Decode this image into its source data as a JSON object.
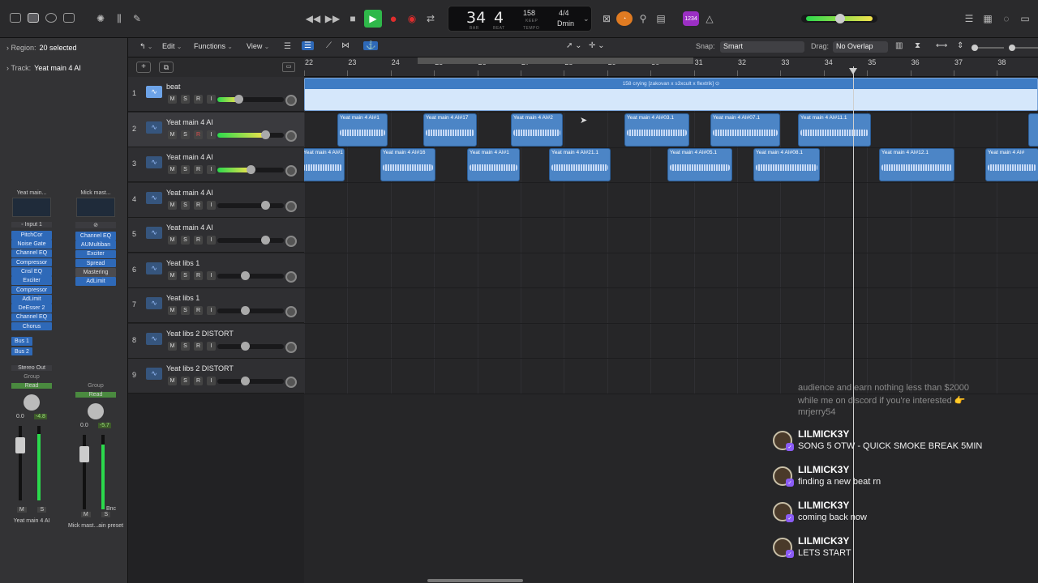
{
  "transport": {
    "bar": "34",
    "beat": "4",
    "bar_label": "BAR",
    "beat_label": "BEAT",
    "tempo": "158",
    "tempo_mode": "KEEP",
    "tempo_label": "TEMPO",
    "signature": "4/4",
    "key": "Dmin",
    "count_in_badge": "1234"
  },
  "inspector": {
    "region_label": "Region:",
    "region_value": "20 selected",
    "track_label": "Track:",
    "track_value": "Yeat main 4 AI",
    "strip1": {
      "setting": "Yeat main...",
      "input": "Input 1",
      "plugins": [
        "PitchCor",
        "Noise Gate",
        "Channel EQ",
        "Compressor",
        "Cnsl EQ",
        "Exciter",
        "Compressor",
        "AdLimit",
        "DeEsser 2",
        "Channel EQ",
        "Chorus"
      ],
      "sends": [
        "Bus 1",
        "Bus 2"
      ],
      "output": "Stereo Out",
      "group": "Group",
      "automation": "Read",
      "volume": "0.0",
      "peak": "-4.8",
      "mute": "M",
      "solo": "S",
      "name": "Yeat main 4 AI"
    },
    "strip2": {
      "setting": "Mick mast...",
      "plugins": [
        "Channel EQ",
        "AUMultiban",
        "Exciter",
        "Spread",
        "Mastering",
        "AdLimit"
      ],
      "group": "Group",
      "automation": "Read",
      "volume": "0.0",
      "peak": "-5.7",
      "bounce": "Bnc",
      "mute": "M",
      "solo": "S",
      "name": "Mick mast...ain preset"
    }
  },
  "toolbar": {
    "edit": "Edit",
    "functions": "Functions",
    "view": "View",
    "snap_label": "Snap:",
    "snap_value": "Smart",
    "drag_label": "Drag:",
    "drag_value": "No Overlap"
  },
  "ruler": [
    "22",
    "23",
    "24",
    "25",
    "26",
    "27",
    "28",
    "29",
    "30",
    "31",
    "32",
    "33",
    "34",
    "35",
    "36",
    "37",
    "38"
  ],
  "tracks": [
    {
      "num": "1",
      "name": "beat",
      "level": 0.32
    },
    {
      "num": "2",
      "name": "Yeat main 4 AI",
      "level": 0.72
    },
    {
      "num": "3",
      "name": "Yeat main 4 AI",
      "level": 0.5
    },
    {
      "num": "4",
      "name": "Yeat main 4 AI",
      "level": 0.72
    },
    {
      "num": "5",
      "name": "Yeat main 4 AI",
      "level": 0.72
    },
    {
      "num": "6",
      "name": "Yeat libs 1",
      "level": 0.42
    },
    {
      "num": "7",
      "name": "Yeat libs 1",
      "level": 0.42
    },
    {
      "num": "8",
      "name": "Yeat libs 2 DISTORT",
      "level": 0.42
    },
    {
      "num": "9",
      "name": "Yeat libs 2 DISTORT",
      "level": 0.42
    }
  ],
  "msri": [
    "M",
    "S",
    "R",
    "I"
  ],
  "beat_region": "158 crying [zakovan x s3xcult x flextrik]",
  "regions_track2": [
    "Yeat main 4 AI#1",
    "Yeat main 4 AI#17",
    "Yeat main 4 AI#2",
    "Yeat main 4 AI#03.1",
    "Yeat main 4 AI#07.1",
    "Yeat main 4 AI#11.1"
  ],
  "regions_track3": [
    "Yeat main 4 AI#1",
    "Yeat main 4 AI#16",
    "Yeat main 4 AI#1",
    "Yeat main 4 AI#21.1",
    "Yeat main 4 AI#05.1",
    "Yeat main 4 AI#08.1",
    "Yeat main 4 AI#12.1",
    "Yeat main 4 AI#"
  ],
  "chat": {
    "older": [
      "audience and earn nothing less than $2000",
      "while me on discord if you're interested 👉",
      "mrjerry54"
    ],
    "messages": [
      {
        "user": "LILMICK3Y",
        "text": "SONG 5 OTW - QUICK SMOKE BREAK 5MIN"
      },
      {
        "user": "LILMICK3Y",
        "text": "finding a new beat rn"
      },
      {
        "user": "LILMICK3Y",
        "text": "coming back now"
      },
      {
        "user": "LILMICK3Y",
        "text": "LETS START"
      }
    ]
  },
  "colors": {
    "region": "#4c85c6",
    "play": "#2fb84a",
    "record": "#e02d2d",
    "fader_green": "#2bd94c"
  }
}
